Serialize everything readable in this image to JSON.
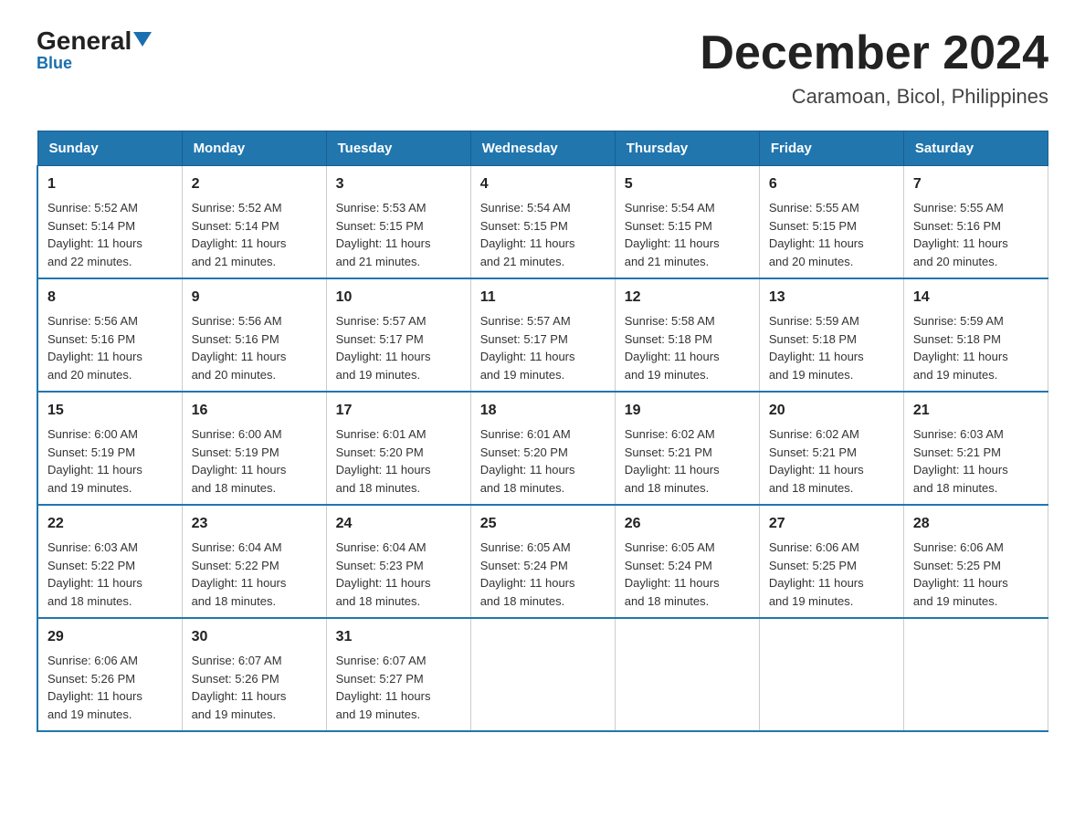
{
  "logo": {
    "line1": "General",
    "line2": "Blue",
    "triangle": "▶"
  },
  "title": "December 2024",
  "subtitle": "Caramoan, Bicol, Philippines",
  "days_of_week": [
    "Sunday",
    "Monday",
    "Tuesday",
    "Wednesday",
    "Thursday",
    "Friday",
    "Saturday"
  ],
  "weeks": [
    [
      {
        "day": "1",
        "info": "Sunrise: 5:52 AM\nSunset: 5:14 PM\nDaylight: 11 hours\nand 22 minutes."
      },
      {
        "day": "2",
        "info": "Sunrise: 5:52 AM\nSunset: 5:14 PM\nDaylight: 11 hours\nand 21 minutes."
      },
      {
        "day": "3",
        "info": "Sunrise: 5:53 AM\nSunset: 5:15 PM\nDaylight: 11 hours\nand 21 minutes."
      },
      {
        "day": "4",
        "info": "Sunrise: 5:54 AM\nSunset: 5:15 PM\nDaylight: 11 hours\nand 21 minutes."
      },
      {
        "day": "5",
        "info": "Sunrise: 5:54 AM\nSunset: 5:15 PM\nDaylight: 11 hours\nand 21 minutes."
      },
      {
        "day": "6",
        "info": "Sunrise: 5:55 AM\nSunset: 5:15 PM\nDaylight: 11 hours\nand 20 minutes."
      },
      {
        "day": "7",
        "info": "Sunrise: 5:55 AM\nSunset: 5:16 PM\nDaylight: 11 hours\nand 20 minutes."
      }
    ],
    [
      {
        "day": "8",
        "info": "Sunrise: 5:56 AM\nSunset: 5:16 PM\nDaylight: 11 hours\nand 20 minutes."
      },
      {
        "day": "9",
        "info": "Sunrise: 5:56 AM\nSunset: 5:16 PM\nDaylight: 11 hours\nand 20 minutes."
      },
      {
        "day": "10",
        "info": "Sunrise: 5:57 AM\nSunset: 5:17 PM\nDaylight: 11 hours\nand 19 minutes."
      },
      {
        "day": "11",
        "info": "Sunrise: 5:57 AM\nSunset: 5:17 PM\nDaylight: 11 hours\nand 19 minutes."
      },
      {
        "day": "12",
        "info": "Sunrise: 5:58 AM\nSunset: 5:18 PM\nDaylight: 11 hours\nand 19 minutes."
      },
      {
        "day": "13",
        "info": "Sunrise: 5:59 AM\nSunset: 5:18 PM\nDaylight: 11 hours\nand 19 minutes."
      },
      {
        "day": "14",
        "info": "Sunrise: 5:59 AM\nSunset: 5:18 PM\nDaylight: 11 hours\nand 19 minutes."
      }
    ],
    [
      {
        "day": "15",
        "info": "Sunrise: 6:00 AM\nSunset: 5:19 PM\nDaylight: 11 hours\nand 19 minutes."
      },
      {
        "day": "16",
        "info": "Sunrise: 6:00 AM\nSunset: 5:19 PM\nDaylight: 11 hours\nand 18 minutes."
      },
      {
        "day": "17",
        "info": "Sunrise: 6:01 AM\nSunset: 5:20 PM\nDaylight: 11 hours\nand 18 minutes."
      },
      {
        "day": "18",
        "info": "Sunrise: 6:01 AM\nSunset: 5:20 PM\nDaylight: 11 hours\nand 18 minutes."
      },
      {
        "day": "19",
        "info": "Sunrise: 6:02 AM\nSunset: 5:21 PM\nDaylight: 11 hours\nand 18 minutes."
      },
      {
        "day": "20",
        "info": "Sunrise: 6:02 AM\nSunset: 5:21 PM\nDaylight: 11 hours\nand 18 minutes."
      },
      {
        "day": "21",
        "info": "Sunrise: 6:03 AM\nSunset: 5:21 PM\nDaylight: 11 hours\nand 18 minutes."
      }
    ],
    [
      {
        "day": "22",
        "info": "Sunrise: 6:03 AM\nSunset: 5:22 PM\nDaylight: 11 hours\nand 18 minutes."
      },
      {
        "day": "23",
        "info": "Sunrise: 6:04 AM\nSunset: 5:22 PM\nDaylight: 11 hours\nand 18 minutes."
      },
      {
        "day": "24",
        "info": "Sunrise: 6:04 AM\nSunset: 5:23 PM\nDaylight: 11 hours\nand 18 minutes."
      },
      {
        "day": "25",
        "info": "Sunrise: 6:05 AM\nSunset: 5:24 PM\nDaylight: 11 hours\nand 18 minutes."
      },
      {
        "day": "26",
        "info": "Sunrise: 6:05 AM\nSunset: 5:24 PM\nDaylight: 11 hours\nand 18 minutes."
      },
      {
        "day": "27",
        "info": "Sunrise: 6:06 AM\nSunset: 5:25 PM\nDaylight: 11 hours\nand 19 minutes."
      },
      {
        "day": "28",
        "info": "Sunrise: 6:06 AM\nSunset: 5:25 PM\nDaylight: 11 hours\nand 19 minutes."
      }
    ],
    [
      {
        "day": "29",
        "info": "Sunrise: 6:06 AM\nSunset: 5:26 PM\nDaylight: 11 hours\nand 19 minutes."
      },
      {
        "day": "30",
        "info": "Sunrise: 6:07 AM\nSunset: 5:26 PM\nDaylight: 11 hours\nand 19 minutes."
      },
      {
        "day": "31",
        "info": "Sunrise: 6:07 AM\nSunset: 5:27 PM\nDaylight: 11 hours\nand 19 minutes."
      },
      null,
      null,
      null,
      null
    ]
  ]
}
